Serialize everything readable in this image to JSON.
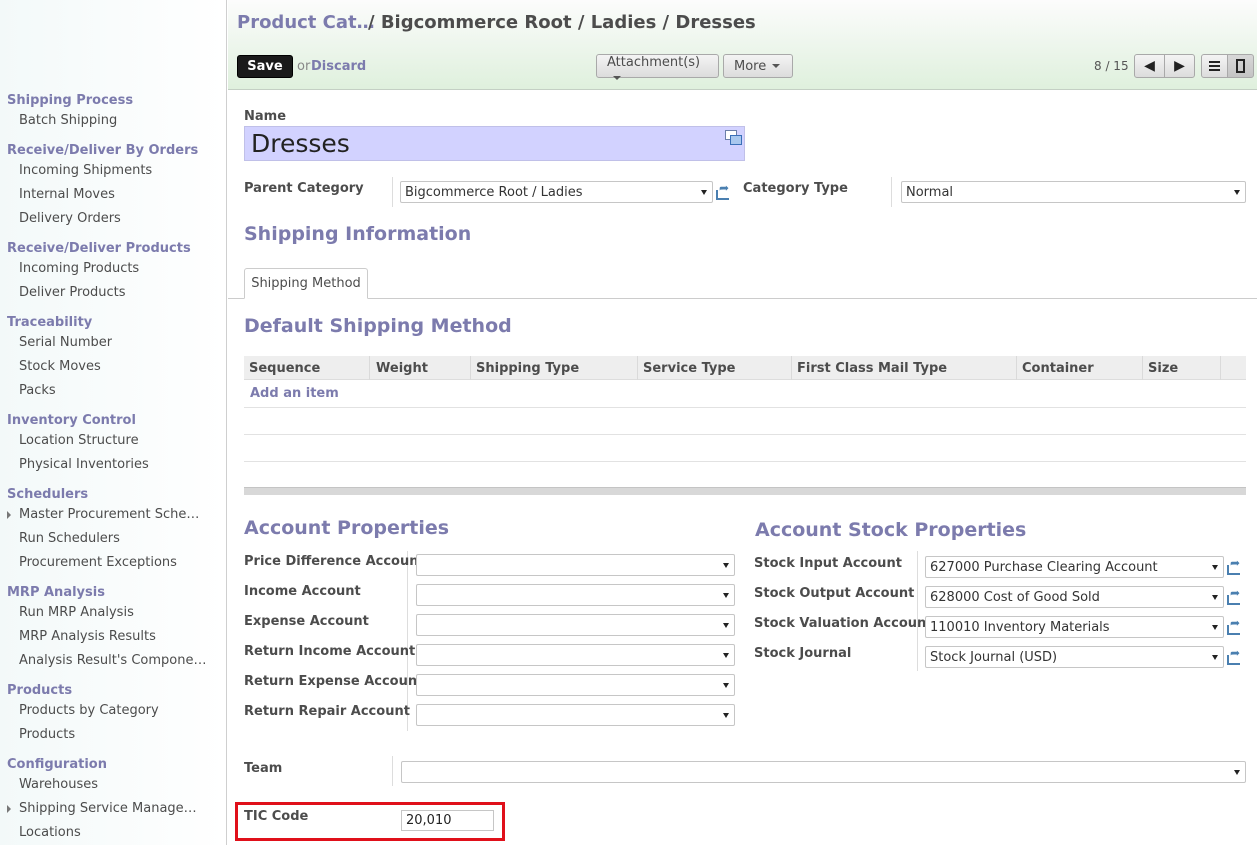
{
  "sidebar": {
    "sections": [
      {
        "title": "Shipping Process",
        "items": [
          "Batch Shipping"
        ]
      },
      {
        "title": "Receive/Deliver By Orders",
        "items": [
          "Incoming Shipments",
          "Internal Moves",
          "Delivery Orders"
        ]
      },
      {
        "title": "Receive/Deliver Products",
        "items": [
          "Incoming Products",
          "Deliver Products"
        ]
      },
      {
        "title": "Traceability",
        "items": [
          "Serial Number",
          "Stock Moves",
          "Packs"
        ]
      },
      {
        "title": "Inventory Control",
        "items": [
          "Location Structure",
          "Physical Inventories"
        ]
      },
      {
        "title": "Schedulers",
        "items": [
          "Master Procurement Sche…",
          "Run Schedulers",
          "Procurement Exceptions"
        ]
      },
      {
        "title": "MRP Analysis",
        "items": [
          "Run MRP Analysis",
          "MRP Analysis Results",
          "Analysis Result's Compone…"
        ]
      },
      {
        "title": "Products",
        "items": [
          "Products by Category",
          "Products"
        ]
      },
      {
        "title": "Configuration",
        "items": [
          "Warehouses",
          "Shipping Service Manage…",
          "Locations"
        ]
      }
    ]
  },
  "header": {
    "breadcrumb_link": "Product Cat…",
    "breadcrumb_current": "/ Bigcommerce Root / Ladies / Dresses",
    "save_label": "Save",
    "or_text": "or",
    "discard_label": "Discard",
    "attachments_label": "Attachment(s)",
    "more_label": "More",
    "pager": "8 / 15"
  },
  "form": {
    "name_label": "Name",
    "name_value": "Dresses",
    "parent_category_label": "Parent Category",
    "parent_category_value": "Bigcommerce Root / Ladies",
    "category_type_label": "Category Type",
    "category_type_value": "Normal",
    "shipping_info_title": "Shipping Information",
    "tab_label": "Shipping Method",
    "default_shipping_title": "Default Shipping Method",
    "grid_columns": [
      "Sequence",
      "Weight",
      "Shipping Type",
      "Service Type",
      "First Class Mail Type",
      "Container",
      "Size"
    ],
    "add_item_label": "Add an item",
    "account_properties_title": "Account Properties",
    "account_fields": [
      {
        "label": "Price Difference Account",
        "value": ""
      },
      {
        "label": "Income Account",
        "value": ""
      },
      {
        "label": "Expense Account",
        "value": ""
      },
      {
        "label": "Return Income Account",
        "value": ""
      },
      {
        "label": "Return Expense Account",
        "value": ""
      },
      {
        "label": "Return Repair Account",
        "value": ""
      }
    ],
    "stock_properties_title": "Account Stock Properties",
    "stock_fields": [
      {
        "label": "Stock Input Account",
        "value": "627000 Purchase Clearing Account"
      },
      {
        "label": "Stock Output Account",
        "value": "628000 Cost of Good Sold"
      },
      {
        "label": "Stock Valuation Account",
        "value": "110010 Inventory Materials"
      },
      {
        "label": "Stock Journal",
        "value": "Stock Journal (USD)"
      }
    ],
    "team_label": "Team",
    "team_value": "",
    "tic_label": "TIC Code",
    "tic_value": "20,010"
  },
  "colors": {
    "accent": "#7c7bad",
    "highlight": "#e0101a",
    "name_field_bg": "#d2d2ff"
  }
}
